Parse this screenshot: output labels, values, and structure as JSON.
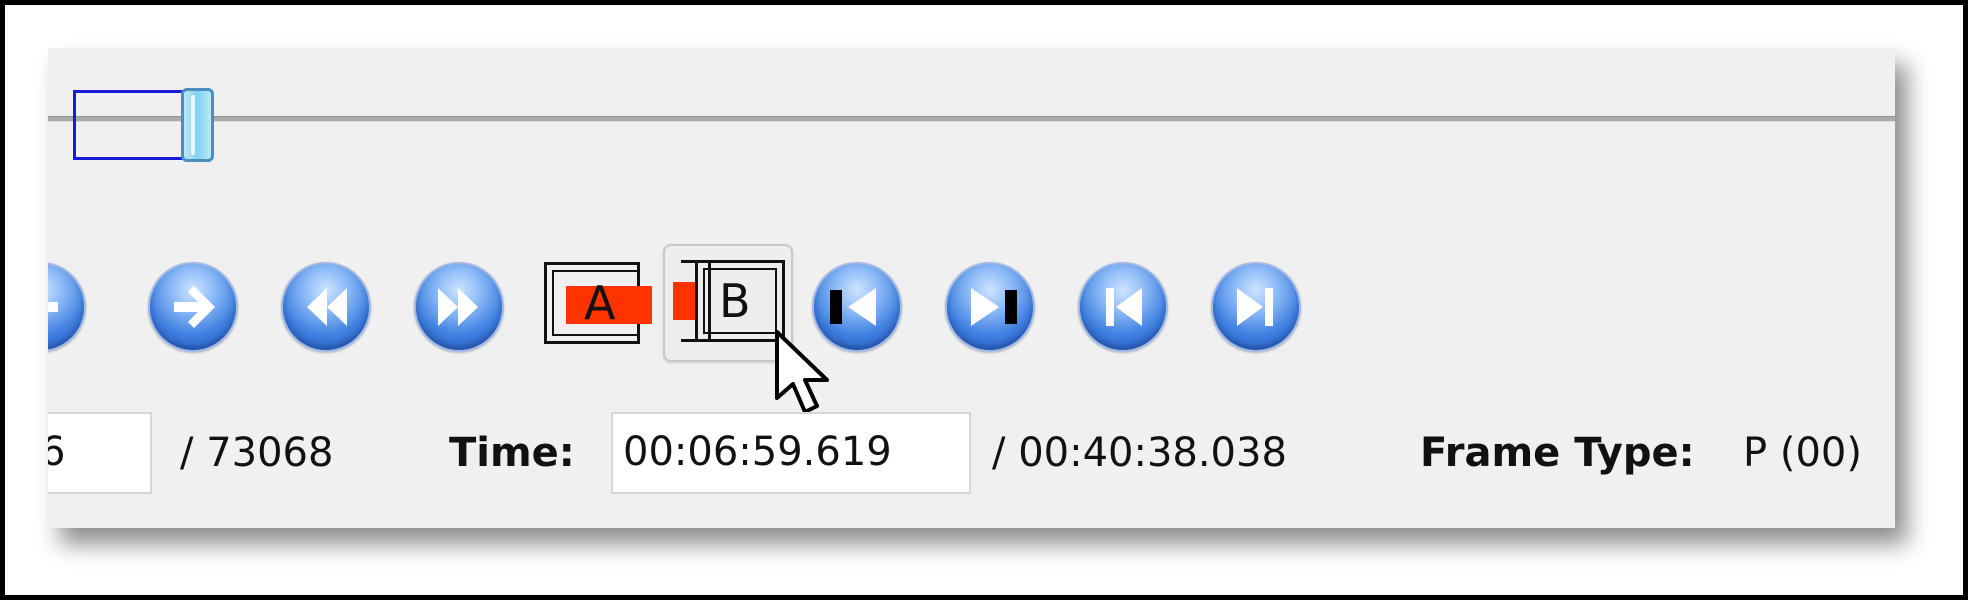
{
  "slider": {
    "position_fraction": 0.055
  },
  "controls": {
    "prev_icon": "arrow-left-icon",
    "next_icon": "arrow-right-icon",
    "rewind_icon": "rewind-icon",
    "fastforward_icon": "fast-forward-icon",
    "marker_a_label": "A",
    "marker_b_label": "B",
    "goto_marker_a_icon": "goto-start-marker-icon",
    "goto_marker_b_icon": "goto-end-marker-icon",
    "prev_keyframe_icon": "previous-keyframe-icon",
    "next_keyframe_icon": "next-keyframe-icon",
    "marker_color": "#ff3300",
    "button_color": "#3f7fe0"
  },
  "status": {
    "frame_value": "6",
    "frame_total": "/ 73068",
    "time_label": "Time:",
    "time_value": "00:06:59.619",
    "time_total": "/ 00:40:38.038",
    "frame_type_label": "Frame Type:",
    "frame_type_value": "P (00)"
  }
}
